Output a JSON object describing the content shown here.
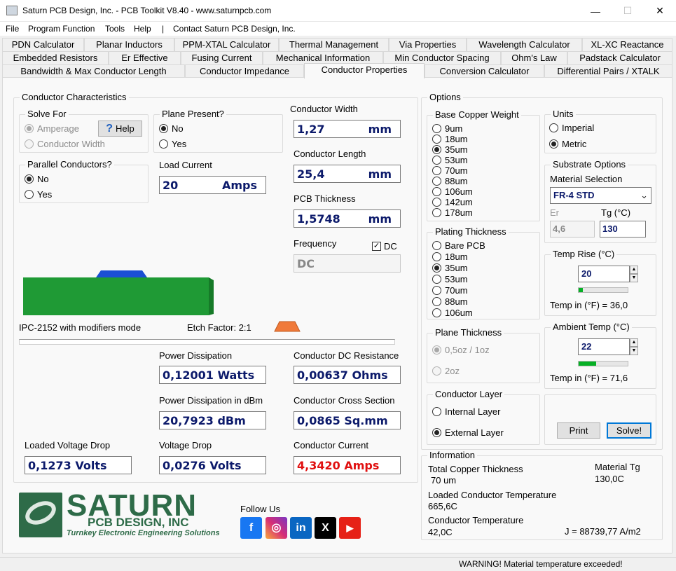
{
  "window": {
    "title": "Saturn PCB Design, Inc. - PCB Toolkit V8.40 - www.saturnpcb.com",
    "min": "—",
    "max": "☐",
    "close": "✕"
  },
  "menu": {
    "file": "File",
    "program_function": "Program Function",
    "tools": "Tools",
    "help": "Help",
    "separator": "|",
    "contact": "Contact Saturn PCB Design, Inc."
  },
  "tabs": {
    "row1": [
      "PDN Calculator",
      "Planar Inductors",
      "PPM-XTAL Calculator",
      "Thermal Management",
      "Via Properties",
      "Wavelength Calculator",
      "XL-XC Reactance"
    ],
    "row2": [
      "Embedded Resistors",
      "Er Effective",
      "Fusing Current",
      "Mechanical Information",
      "Min Conductor Spacing",
      "Ohm's Law",
      "Padstack Calculator"
    ],
    "row3": [
      "Bandwidth & Max Conductor Length",
      "Conductor Impedance",
      "Conductor Properties",
      "Conversion Calculator",
      "Differential Pairs / XTALK"
    ]
  },
  "characteristics": {
    "title": "Conductor Characteristics",
    "solve_for": {
      "title": "Solve For",
      "amperage": "Amperage",
      "conductor_width": "Conductor Width",
      "help": "Help"
    },
    "plane_present": {
      "title": "Plane Present?",
      "no": "No",
      "yes": "Yes"
    },
    "parallel": {
      "title": "Parallel Conductors?",
      "no": "No",
      "yes": "Yes"
    },
    "load_current": {
      "label": "Load Current",
      "value": "20",
      "unit": "Amps"
    },
    "conductor_width": {
      "label": "Conductor Width",
      "value": "1,27",
      "unit": "mm"
    },
    "conductor_length": {
      "label": "Conductor Length",
      "value": "25,4",
      "unit": "mm"
    },
    "pcb_thickness": {
      "label": "PCB Thickness",
      "value": "1,5748",
      "unit": "mm"
    },
    "frequency": {
      "label": "Frequency",
      "value": "DC",
      "dc_label": "DC"
    },
    "mode": "IPC-2152 with modifiers mode",
    "etch_factor": "Etch Factor: 2:1",
    "power_dissipation": {
      "label": "Power Dissipation",
      "value": "0,12001 Watts"
    },
    "dc_resistance": {
      "label": "Conductor DC Resistance",
      "value": "0,00637 Ohms"
    },
    "power_dbm": {
      "label": "Power Dissipation in dBm",
      "value": "20,7923 dBm"
    },
    "cross_section": {
      "label": "Conductor Cross Section",
      "value": "0,0865 Sq.mm"
    },
    "loaded_voltage_drop": {
      "label": "Loaded Voltage Drop",
      "value": "0,1273 Volts"
    },
    "voltage_drop": {
      "label": "Voltage Drop",
      "value": "0,0276 Volts"
    },
    "conductor_current": {
      "label": "Conductor Current",
      "value": "4,3420 Amps",
      "color": "#e01010"
    }
  },
  "options": {
    "title": "Options",
    "base_copper": {
      "title": "Base Copper Weight",
      "items": [
        "9um",
        "18um",
        "35um",
        "53um",
        "70um",
        "88um",
        "106um",
        "142um",
        "178um"
      ],
      "selected": "35um"
    },
    "units": {
      "title": "Units",
      "imperial": "Imperial",
      "metric": "Metric"
    },
    "substrate": {
      "title": "Substrate Options",
      "material_label": "Material Selection",
      "material": "FR-4 STD",
      "er_label": "Er",
      "er": "4,6",
      "tg_label": "Tg (°C)",
      "tg": "130"
    },
    "plating": {
      "title": "Plating Thickness",
      "items": [
        "Bare PCB",
        "18um",
        "35um",
        "53um",
        "70um",
        "88um",
        "106um"
      ],
      "selected": "35um"
    },
    "temp_rise": {
      "title": "Temp Rise (°C)",
      "value": "20",
      "fahrenheit": "Temp in (°F) = 36,0",
      "level": 0.08
    },
    "ambient": {
      "title": "Ambient Temp (°C)",
      "value": "22",
      "fahrenheit": "Temp in (°F) = 71,6",
      "level": 0.35
    },
    "plane_thickness": {
      "title": "Plane Thickness",
      "opt1": "0,5oz / 1oz",
      "opt2": "2oz"
    },
    "layer": {
      "title": "Conductor Layer",
      "internal": "Internal Layer",
      "external": "External Layer"
    },
    "print": "Print",
    "solve": "Solve!"
  },
  "information": {
    "title": "Information",
    "copper_label": "Total Copper Thickness",
    "copper": "70 um",
    "tg_label": "Material Tg",
    "tg": "130,0C",
    "loaded_temp_label": "Loaded Conductor Temperature",
    "loaded_temp": "665,6C",
    "temp_label": "Conductor Temperature",
    "temp": "42,0C",
    "j": "J = 88739,77 A/m2"
  },
  "logo": {
    "name": "SATURN",
    "sub": "PCB DESIGN, INC",
    "tag": "Turnkey Electronic Engineering Solutions"
  },
  "follow_us": "Follow Us",
  "social": {
    "facebook": "f",
    "instagram": "◎",
    "linkedin": "in",
    "x": "X",
    "youtube": "▶"
  },
  "colors": {
    "value_text": "#0c1a6b",
    "pcb_green": "#1f9a35",
    "trace_blue": "#1b4fd4",
    "youtube_red": "#e62117",
    "facebook_blue": "#1877f2",
    "linkedin_blue": "#0a66c2",
    "logo_green": "#1e5c3a"
  },
  "status": "WARNING! Material temperature exceeded!"
}
